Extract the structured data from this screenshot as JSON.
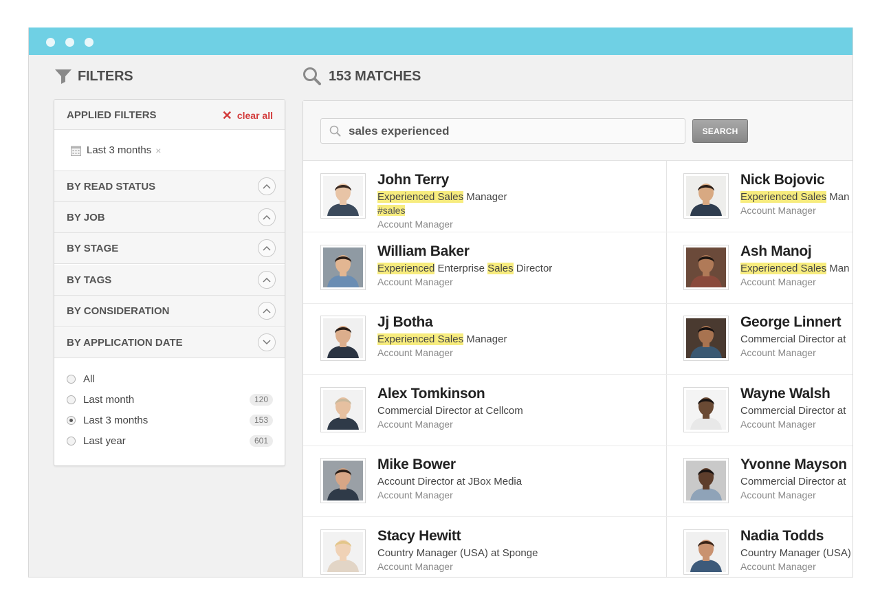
{
  "filters": {
    "heading": "FILTERS",
    "applied_title": "APPLIED FILTERS",
    "clear_all": "clear all",
    "applied_chip": "Last 3 months",
    "sections": [
      "BY READ STATUS",
      "BY JOB",
      "BY STAGE",
      "BY TAGS",
      "BY CONSIDERATION",
      "BY APPLICATION DATE"
    ],
    "date_options": [
      {
        "label": "All",
        "count": ""
      },
      {
        "label": "Last month",
        "count": "120"
      },
      {
        "label": "Last 3 months",
        "count": "153"
      },
      {
        "label": "Last year",
        "count": "601"
      }
    ]
  },
  "results": {
    "heading": "153 MATCHES",
    "search_value": "sales experienced",
    "search_button": "SEARCH"
  },
  "candidates": [
    {
      "name": "John Terry",
      "role": "Account Manager",
      "tag": "#sales",
      "title_parts": [
        {
          "text": "Experienced Sales",
          "hl": true
        },
        {
          "text": " Manager",
          "hl": false
        }
      ]
    },
    {
      "name": "Nick Bojovic",
      "role": "Account Manager",
      "tag": "",
      "title_parts": [
        {
          "text": "Experienced Sales",
          "hl": true
        },
        {
          "text": " Man",
          "hl": false
        }
      ]
    },
    {
      "name": "William Baker",
      "role": "Account Manager",
      "tag": "",
      "title_parts": [
        {
          "text": "Experienced",
          "hl": true
        },
        {
          "text": " Enterprise ",
          "hl": false
        },
        {
          "text": "Sales",
          "hl": true
        },
        {
          "text": " Director",
          "hl": false
        }
      ]
    },
    {
      "name": "Ash Manoj",
      "role": "Account Manager",
      "tag": "",
      "title_parts": [
        {
          "text": "Experienced Sales",
          "hl": true
        },
        {
          "text": " Man",
          "hl": false
        }
      ]
    },
    {
      "name": "Jj Botha",
      "role": "Account Manager",
      "tag": "",
      "title_parts": [
        {
          "text": "Experienced Sales",
          "hl": true
        },
        {
          "text": " Manager",
          "hl": false
        }
      ]
    },
    {
      "name": "George Linnert",
      "role": "Account Manager",
      "tag": "",
      "title_parts": [
        {
          "text": "Commercial Director at",
          "hl": false
        }
      ]
    },
    {
      "name": "Alex Tomkinson",
      "role": "Account Manager",
      "tag": "",
      "title_parts": [
        {
          "text": "Commercial Director at Cellcom",
          "hl": false
        }
      ]
    },
    {
      "name": "Wayne Walsh",
      "role": "Account Manager",
      "tag": "",
      "title_parts": [
        {
          "text": "Commercial Director at",
          "hl": false
        }
      ]
    },
    {
      "name": "Mike Bower",
      "role": "Account Manager",
      "tag": "",
      "title_parts": [
        {
          "text": "Account Director at JBox Media",
          "hl": false
        }
      ]
    },
    {
      "name": "Yvonne Mayson",
      "role": "Account Manager",
      "tag": "",
      "title_parts": [
        {
          "text": "Commercial Director at",
          "hl": false
        }
      ]
    },
    {
      "name": "Stacy Hewitt",
      "role": "Account Manager",
      "tag": "",
      "title_parts": [
        {
          "text": "Country Manager (USA) at Sponge",
          "hl": false
        }
      ]
    },
    {
      "name": "Nadia Todds",
      "role": "Account Manager",
      "tag": "",
      "title_parts": [
        {
          "text": "Country Manager (USA)",
          "hl": false
        }
      ]
    }
  ],
  "colors": {
    "titlebar": "#6fd0e4",
    "highlight": "#f7ec7e",
    "clear_all": "#d23a3a"
  }
}
